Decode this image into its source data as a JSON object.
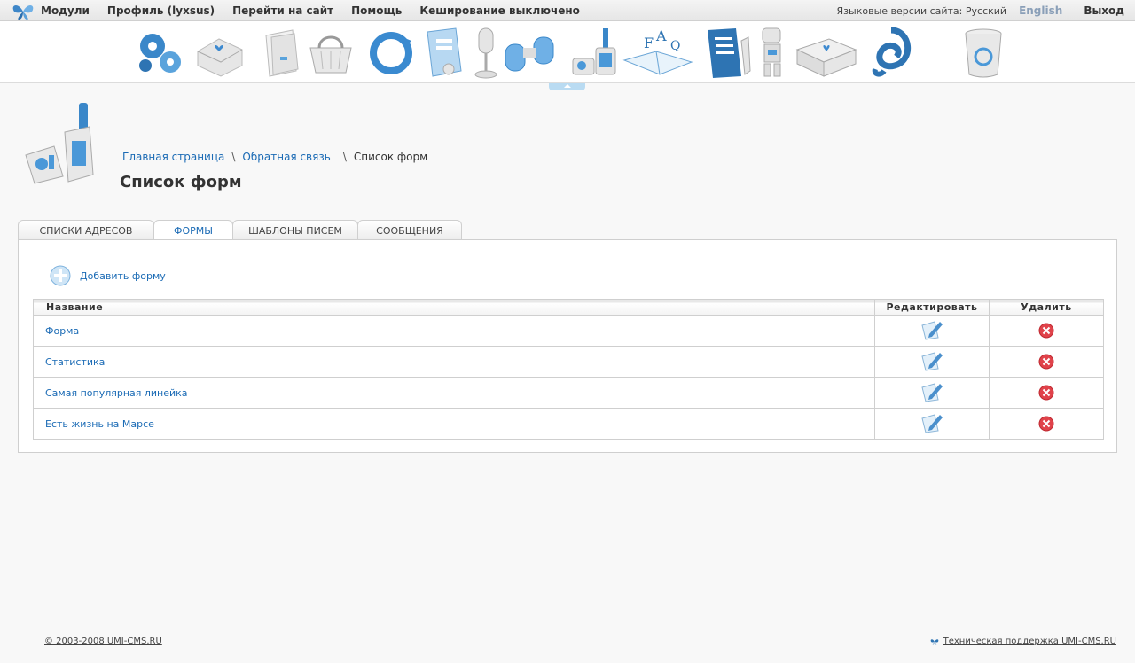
{
  "topbar": {
    "menu": [
      "Модули",
      "Профиль (lyxsus)",
      "Перейти на сайт",
      "Помощь",
      "Кеширование выключено"
    ],
    "lang_label": "Языковые версии сайта: Русский",
    "lang_alt": "English",
    "exit": "Выход"
  },
  "breadcrumb": {
    "home": "Главная страница",
    "section": "Обратная связь",
    "current": "Список форм"
  },
  "page_title": "Список форм",
  "tabs": [
    "СПИСКИ АДРЕСОВ",
    "ФОРМЫ",
    "ШАБЛОНЫ ПИСЕМ",
    "СООБЩЕНИЯ"
  ],
  "active_tab": "ФОРМЫ",
  "add_form_label": "Добавить форму",
  "table": {
    "columns": [
      "Название",
      "Редактировать",
      "Удалить"
    ],
    "rows": [
      "Форма",
      "Статистика",
      "Самая популярная линейка",
      "Есть жизнь на Марсе"
    ]
  },
  "footer": {
    "copyright": "© 2003-2008 UMI-CMS.RU",
    "support": "Техническая поддержка UMI-CMS.RU"
  },
  "colors": {
    "accent": "#1b6bb5",
    "delete": "#e0424a"
  }
}
